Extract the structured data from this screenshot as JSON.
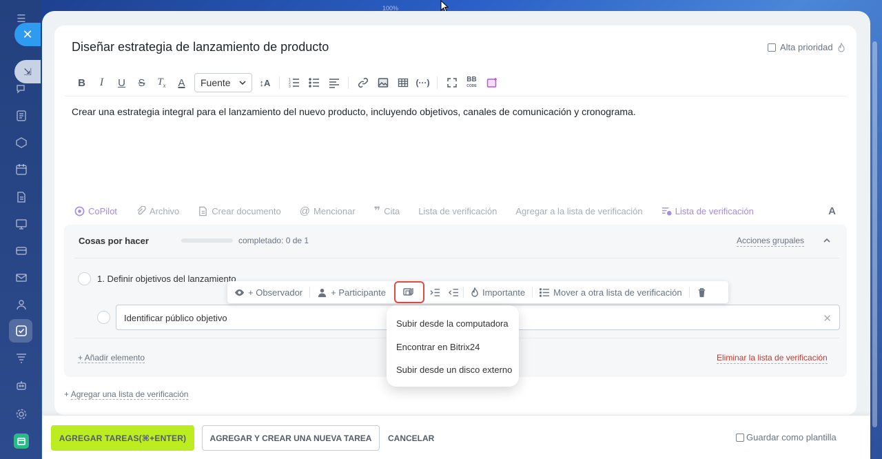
{
  "zoom": "100%",
  "task": {
    "title": "Diseñar estrategia de lanzamiento de producto",
    "high_priority_label": "Alta prioridad",
    "description": "Crear una estrategia integral para el lanzamiento del nuevo producto, incluyendo objetivos, canales de comunicación y cronograma."
  },
  "editor": {
    "font_select": "Fuente",
    "tools": [
      "bold-icon",
      "italic-icon",
      "underline-icon",
      "strikethrough-icon",
      "clear-format-icon",
      "text-color-icon",
      "font-size-icon",
      "numbered-list-icon",
      "bulleted-list-icon",
      "align-icon",
      "link-icon",
      "image-icon",
      "table-icon",
      "code-icon",
      "fullscreen-icon",
      "bbcode-icon",
      "copilot-image-icon"
    ]
  },
  "attach_bar": {
    "copilot": "CoPilot",
    "file": "Archivo",
    "create_doc": "Crear documento",
    "mention": "Mencionar",
    "quote": "Cita",
    "checklist": "Lista de verificación",
    "add_to_checklist": "Agregar a la lista de verificación",
    "checklist_active": "Lista de verificación",
    "format": "A"
  },
  "checklist": {
    "title": "Cosas por hacer",
    "progress_fraction": 0,
    "progress_text": "completado: 0 de 1",
    "group_actions": "Acciones grupales",
    "items": [
      {
        "label": "1. Definir objetivos del lanzamiento"
      }
    ],
    "new_item_value": "Identificar público objetivo",
    "add_item": "+ Añadir elemento",
    "delete_list": "Eliminar la lista de verificación"
  },
  "add_checklist": {
    "prefix": "+ ",
    "label": "Agregar una lista de verificación"
  },
  "item_toolbar": {
    "observer": "+ Observador",
    "participant": "+ Participante",
    "important": "Importante",
    "move": "Mover a otra lista de verificación"
  },
  "attach_menu": {
    "options": [
      "Subir desde la computadora",
      "Encontrar en Bitrix24",
      "Subir desde un disco externo"
    ]
  },
  "footer": {
    "primary": "AGREGAR TAREAS(⌘+ENTER)",
    "secondary": "AGREGAR Y CREAR UNA NUEVA TAREA",
    "cancel": "CANCELAR",
    "save_template": "Guardar como plantilla"
  },
  "colors": {
    "primary_button": "#bbed21",
    "highlight_box": "#e5483d",
    "danger_text": "#d0322b",
    "accent_purple": "#a58ee0"
  }
}
